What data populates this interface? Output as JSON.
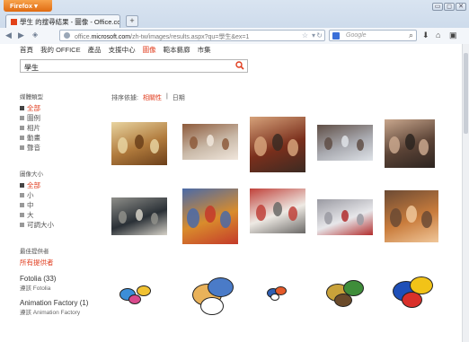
{
  "browser": {
    "menu_button": "Firefox ▾",
    "tab_title": "學生 的搜尋結果 - 圖像 - Office.com",
    "newtab": "+",
    "url_prefix": "office.",
    "url_domain": "microsoft.com",
    "url_path": "/zh-tw/images/results.aspx?qu=學生&ex=1",
    "search_placeholder": "Google",
    "win_controls": [
      "▭",
      "◻",
      "✕"
    ]
  },
  "topnav": {
    "items": [
      {
        "label": "首頁",
        "active": false
      },
      {
        "label": "我的 OFFICE",
        "active": false
      },
      {
        "label": "產品",
        "active": false
      },
      {
        "label": "支援中心",
        "active": false
      },
      {
        "label": "圖像",
        "active": true
      },
      {
        "label": "範本藝廊",
        "active": false
      },
      {
        "label": "市集",
        "active": false
      }
    ]
  },
  "search": {
    "value": "學生"
  },
  "sort": {
    "label": "排序依據:",
    "options": [
      "相關性",
      "日期"
    ],
    "separator": "|"
  },
  "sidebar": {
    "media_type": {
      "title": "媒體類型",
      "items": [
        {
          "label": "全部",
          "selected": true
        },
        {
          "label": "圖例",
          "selected": false
        },
        {
          "label": "相片",
          "selected": false
        },
        {
          "label": "動畫",
          "selected": false
        },
        {
          "label": "聲音",
          "selected": false
        }
      ]
    },
    "image_size": {
      "title": "圖像大小",
      "items": [
        {
          "label": "全部",
          "selected": true
        },
        {
          "label": "小",
          "selected": false
        },
        {
          "label": "中",
          "selected": false
        },
        {
          "label": "大",
          "selected": false
        },
        {
          "label": "可調大小",
          "selected": false
        }
      ]
    },
    "provider": {
      "title": "最佳提供者",
      "all": "所有提供者",
      "providers": [
        {
          "name": "Fotolia (33)",
          "sub": "遵該 Fotolia"
        },
        {
          "name": "Animation Factory (1)",
          "sub": "遵該 Animation Factory"
        }
      ]
    }
  },
  "colors": {
    "accent": "#e03b1c",
    "chrome": "#d3deec"
  },
  "results": [
    {
      "name": "students-classroom-photo",
      "kind": "photo",
      "colors": [
        "#b07a3c",
        "#e8d4a0",
        "#6b3f1a"
      ]
    },
    {
      "name": "two-students-laptop-photo",
      "kind": "photo",
      "colors": [
        "#c9b9a8",
        "#8d5a3b",
        "#f0e6dc"
      ]
    },
    {
      "name": "lecture-hall-photo",
      "kind": "photo",
      "colors": [
        "#7a2f1c",
        "#d6a27a",
        "#3b2a22"
      ]
    },
    {
      "name": "computer-lab-photo",
      "kind": "photo",
      "colors": [
        "#a9aab0",
        "#5f4e45",
        "#dfe3e8"
      ]
    },
    {
      "name": "student-group-photo",
      "kind": "photo",
      "colors": [
        "#5b4336",
        "#c9a78d",
        "#2c2420"
      ]
    },
    {
      "name": "teacher-blackboard-photo",
      "kind": "photo",
      "colors": [
        "#2a3036",
        "#8f8f8a",
        "#d6d2c8"
      ]
    },
    {
      "name": "boy-books-photo",
      "kind": "photo",
      "colors": [
        "#d98c2c",
        "#4a6aa8",
        "#c43a2a"
      ]
    },
    {
      "name": "kids-floor-photo",
      "kind": "photo",
      "colors": [
        "#eeeae4",
        "#c0413a",
        "#6a6866"
      ]
    },
    {
      "name": "student-desk-photo",
      "kind": "photo",
      "colors": [
        "#e7e7ea",
        "#9a9aa2",
        "#b22d2d"
      ]
    },
    {
      "name": "girl-notebook-photo",
      "kind": "photo",
      "colors": [
        "#c97c3c",
        "#6b4a34",
        "#f0c79a"
      ]
    },
    {
      "name": "students-clipart",
      "kind": "clipart",
      "colors": [
        "#3c8ed8",
        "#f1c232",
        "#d94a8c"
      ]
    },
    {
      "name": "boy-reading-clipart",
      "kind": "clipart",
      "colors": [
        "#e9b25a",
        "#4a7bc8",
        "#ffffff"
      ]
    },
    {
      "name": "classroom-small-clipart",
      "kind": "clipart",
      "colors": [
        "#2f5fb3",
        "#e55a2a",
        "#ffffff"
      ]
    },
    {
      "name": "students-desk-clipart",
      "kind": "clipart",
      "colors": [
        "#c9a23a",
        "#3f8d3a",
        "#6a4a2a"
      ]
    },
    {
      "name": "student-reading-clipart",
      "kind": "clipart",
      "colors": [
        "#1e4fb8",
        "#f2c318",
        "#d9302a"
      ]
    }
  ]
}
